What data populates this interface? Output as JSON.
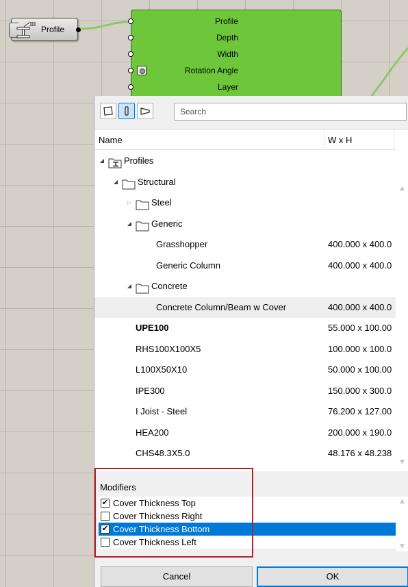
{
  "canvas": {
    "profile_param": {
      "label": "Profile"
    },
    "component": {
      "inputs": [
        "Profile",
        "Depth",
        "Width",
        "Rotation Angle",
        "Layer"
      ]
    },
    "colors": {
      "component_fill": "#6ec73a",
      "wire": "#8fc866",
      "canvas_bg": "#d4d0c8"
    }
  },
  "dialog": {
    "mode_buttons": [
      "closed-profile-icon",
      "vertical-profile-icon",
      "angled-profile-icon"
    ],
    "search": {
      "placeholder": "Search",
      "value": ""
    },
    "columns": {
      "name": "Name",
      "size": "W x H"
    },
    "tree": [
      {
        "label": "Profiles",
        "level": 0,
        "icon": "profiles-icon",
        "expander": "expanded",
        "bold": false,
        "size": ""
      },
      {
        "label": "Structural",
        "level": 1,
        "icon": "folder-icon",
        "expander": "expanded",
        "bold": false,
        "size": ""
      },
      {
        "label": "Steel",
        "level": 2,
        "icon": "folder-icon",
        "expander": "collapsed",
        "bold": false,
        "size": ""
      },
      {
        "label": "Generic",
        "level": 2,
        "icon": "folder-icon",
        "expander": "expanded",
        "bold": false,
        "size": ""
      },
      {
        "label": "Grasshopper",
        "level": 3,
        "icon": "",
        "expander": "",
        "bold": false,
        "size": "400.000 x 400.0"
      },
      {
        "label": "Generic Column",
        "level": 3,
        "icon": "",
        "expander": "",
        "bold": false,
        "size": "400.000 x 400.0"
      },
      {
        "label": "Concrete",
        "level": 2,
        "icon": "folder-icon",
        "expander": "expanded",
        "bold": false,
        "size": ""
      },
      {
        "label": "Concrete Column/Beam w Cover",
        "level": 3,
        "icon": "",
        "expander": "",
        "bold": false,
        "size": "400.000 x 400.0",
        "highlight": true
      },
      {
        "label": "UPE100",
        "level": 2,
        "icon": "",
        "expander": "",
        "bold": true,
        "size": "55.000 x 100.00"
      },
      {
        "label": "RHS100X100X5",
        "level": 2,
        "icon": "",
        "expander": "",
        "bold": false,
        "size": "100.000 x 100.0"
      },
      {
        "label": "L100X50X10",
        "level": 2,
        "icon": "",
        "expander": "",
        "bold": false,
        "size": "50.000 x 100.00"
      },
      {
        "label": "IPE300",
        "level": 2,
        "icon": "",
        "expander": "",
        "bold": false,
        "size": "150.000 x 300.0"
      },
      {
        "label": "I Joist - Steel",
        "level": 2,
        "icon": "",
        "expander": "",
        "bold": false,
        "size": "76.200 x 127.00"
      },
      {
        "label": "HEA200",
        "level": 2,
        "icon": "",
        "expander": "",
        "bold": false,
        "size": "200.000 x 190.0"
      },
      {
        "label": "CHS48.3X5.0",
        "level": 2,
        "icon": "",
        "expander": "",
        "bold": false,
        "size": "48.176 x 48.238"
      }
    ],
    "modifiers": {
      "title": "Modifiers",
      "items": [
        {
          "label": "Cover Thickness Top",
          "checked": true,
          "selected": false
        },
        {
          "label": "Cover Thickness Right",
          "checked": false,
          "selected": false
        },
        {
          "label": "Cover Thickness Bottom",
          "checked": true,
          "selected": true
        },
        {
          "label": "Cover Thickness Left",
          "checked": false,
          "selected": false
        }
      ],
      "frame_color": "#b2202b",
      "selection_color": "#0078d7"
    },
    "buttons": {
      "cancel": "Cancel",
      "ok": "OK"
    }
  }
}
